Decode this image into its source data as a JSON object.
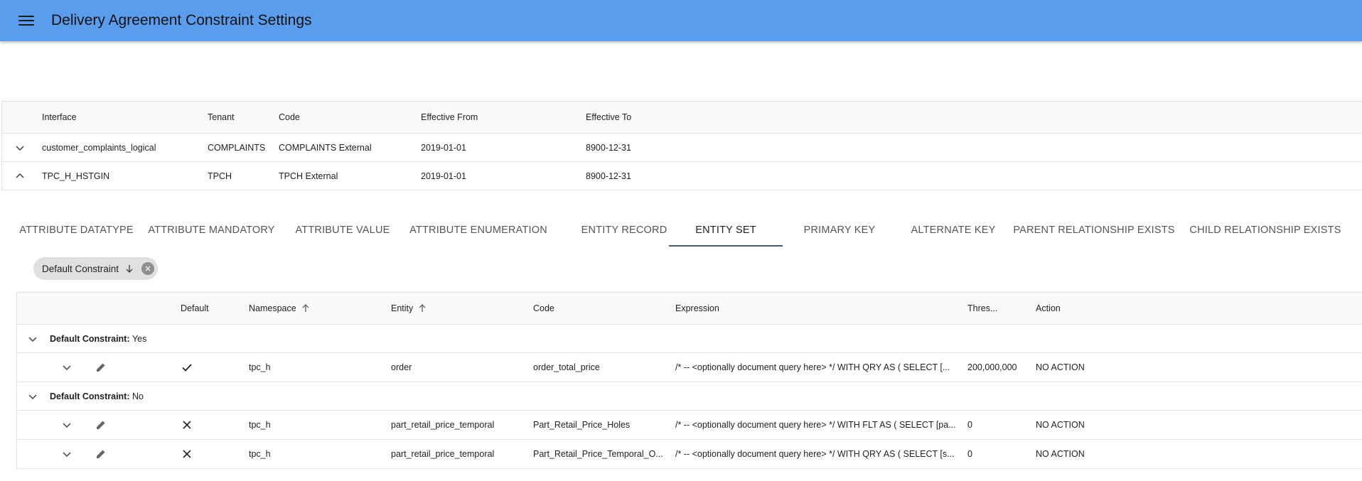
{
  "appbar": {
    "title": "Delivery Agreement Constraint Settings",
    "menu_icon": "menu-icon"
  },
  "outer_table": {
    "headers": [
      "Interface",
      "Tenant",
      "Code",
      "Effective From",
      "Effective To"
    ],
    "rows": [
      {
        "expanded": false,
        "cells": [
          "customer_complaints_logical",
          "COMPLAINTS",
          "COMPLAINTS External",
          "2019-01-01",
          "8900-12-31"
        ]
      },
      {
        "expanded": true,
        "cells": [
          "TPC_H_HSTGIN",
          "TPCH",
          "TPCH External",
          "2019-01-01",
          "8900-12-31"
        ]
      }
    ]
  },
  "tabs": [
    "ATTRIBUTE DATATYPE",
    "ATTRIBUTE MANDATORY",
    "ATTRIBUTE VALUE",
    "ATTRIBUTE ENUMERATION",
    "ENTITY RECORD",
    "ENTITY SET",
    "PRIMARY KEY",
    "ALTERNATE KEY",
    "PARENT RELATIONSHIP EXISTS",
    "CHILD RELATIONSHIP EXISTS"
  ],
  "active_tab": "ENTITY SET",
  "group_chip": {
    "label": "Default Constraint"
  },
  "inner_table": {
    "headers": [
      "Default",
      "Namespace",
      "Entity",
      "Code",
      "Expression",
      "Thres...",
      "Action"
    ],
    "groups": [
      {
        "label": "Default Constraint:",
        "value": "Yes"
      },
      {
        "label": "Default Constraint:",
        "value": "No"
      }
    ],
    "rows": [
      {
        "default": true,
        "namespace": "tpc_h",
        "entity": "order",
        "code": "order_total_price",
        "expression": "/* -- <optionally document query here> */ WITH QRY AS  ( SELECT  [...",
        "threshold": "200,000,000",
        "action": "NO ACTION"
      },
      {
        "default": false,
        "namespace": "tpc_h",
        "entity": "part_retail_price_temporal",
        "code": "Part_Retail_Price_Holes",
        "expression": "/* -- <optionally document query here> */ WITH FLT AS ( SELECT  [pa...",
        "threshold": "0",
        "action": "NO ACTION"
      },
      {
        "default": false,
        "namespace": "tpc_h",
        "entity": "part_retail_price_temporal",
        "code": "Part_Retail_Price_Temporal_O...",
        "expression": "/* -- <optionally document query here> */ WITH QRY AS  ( SELECT  [s...",
        "threshold": "0",
        "action": "NO ACTION"
      }
    ]
  }
}
